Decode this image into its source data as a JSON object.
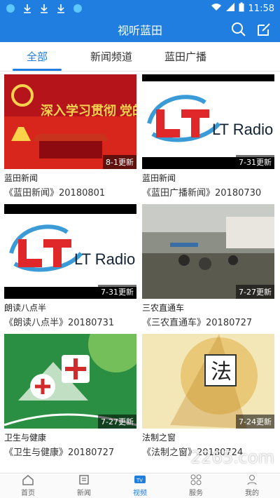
{
  "status": {
    "time": "11:58"
  },
  "header": {
    "title": "视听蓝田"
  },
  "tabs": [
    {
      "label": "全部",
      "active": true
    },
    {
      "label": "新闻频道",
      "active": false
    },
    {
      "label": "蓝田广播",
      "active": false
    }
  ],
  "cards": [
    {
      "name": "蓝田新闻",
      "subtitle": "《蓝田新闻》20180801",
      "badge": "8-1更新",
      "thumb_type": "party-red",
      "thumb_text": "深入学习贯彻 党的十九大精神"
    },
    {
      "name": "蓝田新闻",
      "subtitle": "《蓝田广播新闻》20180730",
      "badge": "7-31更新",
      "thumb_type": "radio",
      "thumb_text": "LT Radio"
    },
    {
      "name": "朗读八点半",
      "subtitle": "《朗读八点半》20180731",
      "badge": "7-31更新",
      "thumb_type": "radio",
      "thumb_text": "LT Radio"
    },
    {
      "name": "三农直通车",
      "subtitle": "《三农直通车》20180727",
      "badge": "7-27更新",
      "thumb_type": "market"
    },
    {
      "name": "卫生与健康",
      "subtitle": "《卫生与健康》20180727",
      "badge": "7-27更新",
      "thumb_type": "health-green"
    },
    {
      "name": "法制之窗",
      "subtitle": "《法制之窗》20180724",
      "badge": "7-24更新",
      "thumb_type": "law",
      "thumb_text": "法"
    }
  ],
  "bottom_nav": [
    {
      "label": "首页",
      "icon": "home-icon",
      "active": false
    },
    {
      "label": "新闻",
      "icon": "news-icon",
      "active": false
    },
    {
      "label": "视频",
      "icon": "tv-icon",
      "active": true
    },
    {
      "label": "服务",
      "icon": "grid-icon",
      "active": false
    },
    {
      "label": "我的",
      "icon": "profile-icon",
      "active": false
    }
  ],
  "watermark": "2265.com"
}
